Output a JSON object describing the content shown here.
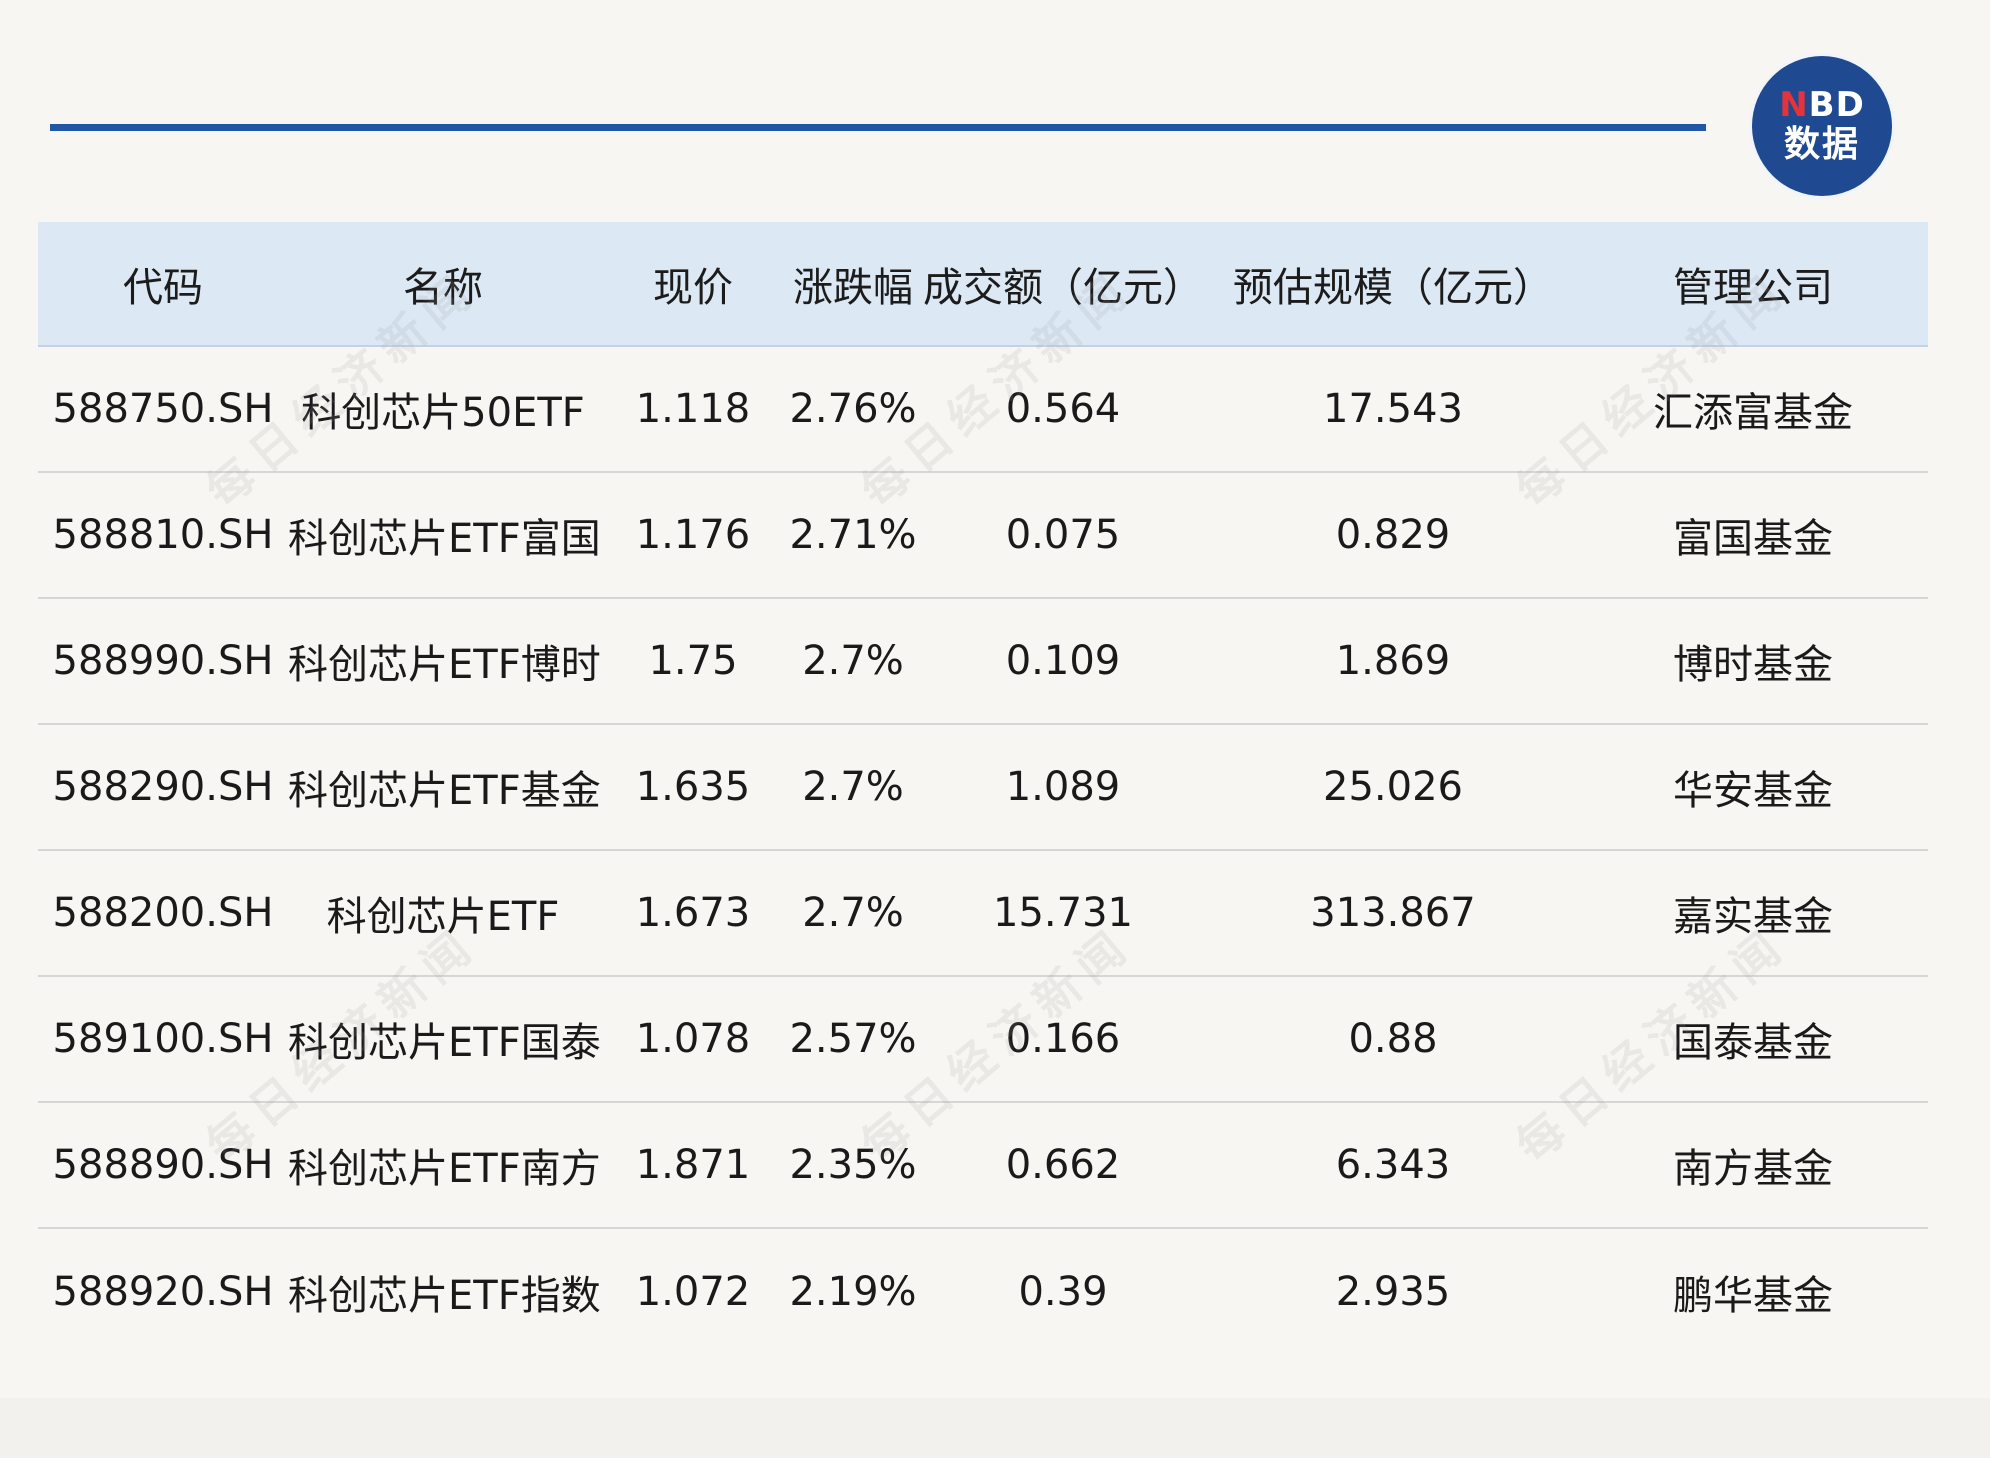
{
  "brand": {
    "logo_line1_accent": "N",
    "logo_line1_rest": "BD",
    "logo_line2": "数据"
  },
  "watermark": "每日经济新闻",
  "table": {
    "headers": [
      "代码",
      "名称",
      "现价",
      "涨跌幅",
      "成交额（亿元）",
      "预估规模（亿元）",
      "管理公司"
    ],
    "rows": [
      [
        "588750.SH",
        "科创芯片50ETF",
        "1.118",
        "2.76%",
        "0.564",
        "17.543",
        "汇添富基金"
      ],
      [
        "588810.SH",
        "科创芯片ETF富国",
        "1.176",
        "2.71%",
        "0.075",
        "0.829",
        "富国基金"
      ],
      [
        "588990.SH",
        "科创芯片ETF博时",
        "1.75",
        "2.7%",
        "0.109",
        "1.869",
        "博时基金"
      ],
      [
        "588290.SH",
        "科创芯片ETF基金",
        "1.635",
        "2.7%",
        "1.089",
        "25.026",
        "华安基金"
      ],
      [
        "588200.SH",
        "科创芯片ETF",
        "1.673",
        "2.7%",
        "15.731",
        "313.867",
        "嘉实基金"
      ],
      [
        "589100.SH",
        "科创芯片ETF国泰",
        "1.078",
        "2.57%",
        "0.166",
        "0.88",
        "国泰基金"
      ],
      [
        "588890.SH",
        "科创芯片ETF南方",
        "1.871",
        "2.35%",
        "0.662",
        "6.343",
        "南方基金"
      ],
      [
        "588920.SH",
        "科创芯片ETF指数",
        "1.072",
        "2.19%",
        "0.39",
        "2.935",
        "鹏华基金"
      ]
    ]
  }
}
